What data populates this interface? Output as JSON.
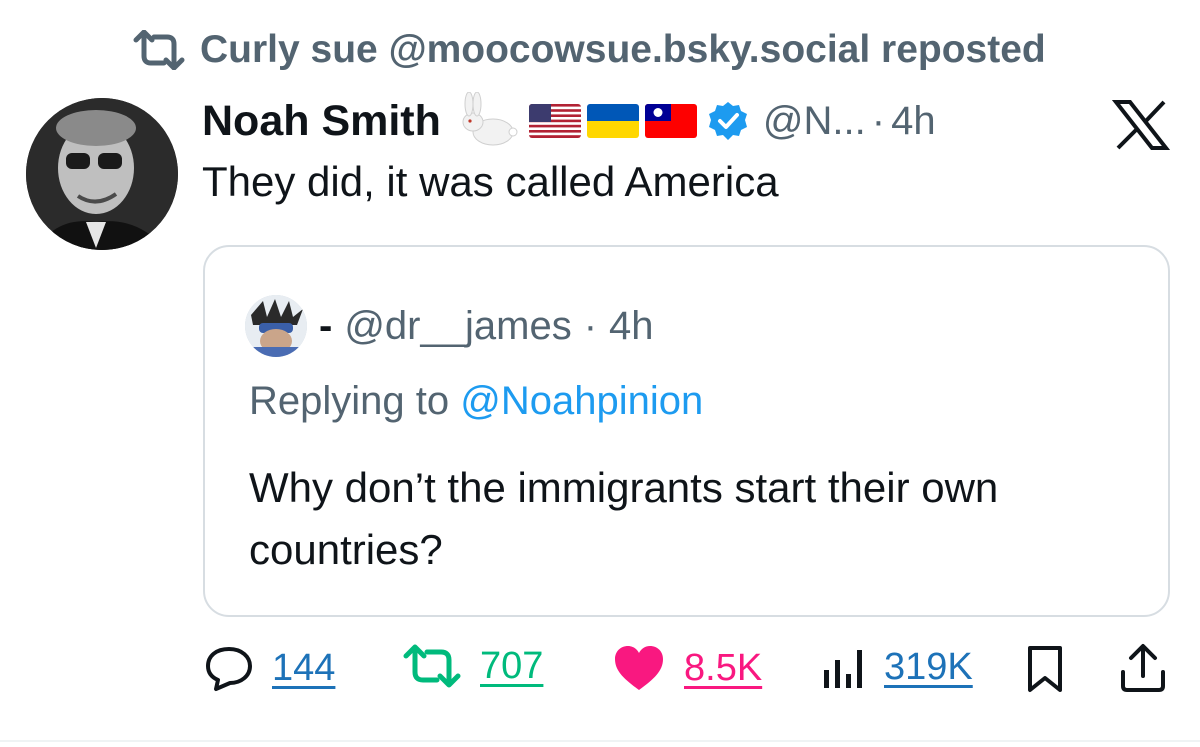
{
  "repost": {
    "text": "Curly sue @moocowsue.bsky.social reposted"
  },
  "post": {
    "display_name": "Noah Smith",
    "handle": "@N...",
    "separator": "·",
    "time": "4h",
    "text": "They did, it was called America"
  },
  "quote": {
    "name": "-",
    "handle": "@dr__james",
    "separator": "·",
    "time": "4h",
    "replying_prefix": "Replying to",
    "replying_handle": "@Noahpinion",
    "text": "Why don’t the immigrants start their own countries?"
  },
  "actions": {
    "replies": "144",
    "reposts": "707",
    "likes": "8.5K",
    "views": "319K"
  },
  "colors": {
    "muted": "#536471",
    "link": "#1d9bf0",
    "repost_green": "#00ba7c",
    "like_pink": "#f91880",
    "view_blue": "#1d72b8"
  }
}
